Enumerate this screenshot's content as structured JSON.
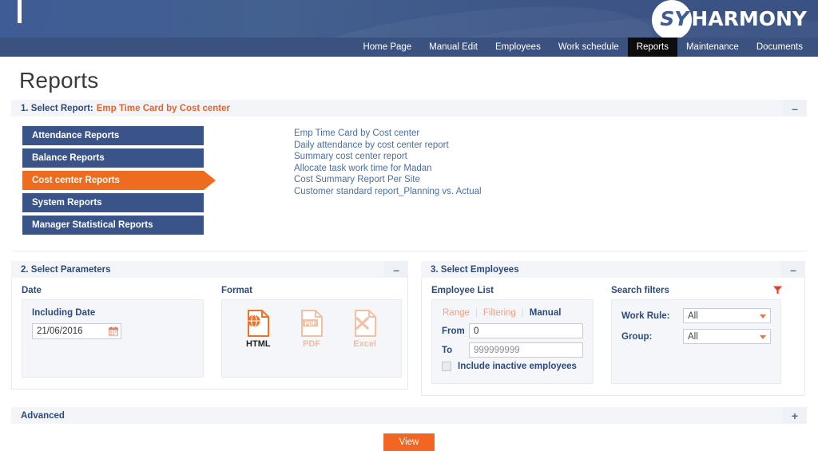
{
  "brand": {
    "logo_sy": "SY",
    "logo_harmony": "HARMONY"
  },
  "nav": {
    "items": [
      {
        "label": "Home Page",
        "active": false
      },
      {
        "label": "Manual Edit",
        "active": false
      },
      {
        "label": "Employees",
        "active": false
      },
      {
        "label": "Work schedule",
        "active": false
      },
      {
        "label": "Reports",
        "active": true
      },
      {
        "label": "Maintenance",
        "active": false
      },
      {
        "label": "Documents",
        "active": false
      }
    ]
  },
  "page": {
    "title": "Reports"
  },
  "section1": {
    "header_label": "1. Select Report:",
    "selected_report": "Emp Time Card by Cost center",
    "toggle": "–",
    "categories": [
      {
        "label": "Attendance Reports",
        "active": false
      },
      {
        "label": "Balance Reports",
        "active": false
      },
      {
        "label": "Cost center Reports",
        "active": true
      },
      {
        "label": "System Reports",
        "active": false
      },
      {
        "label": "Manager Statistical Reports",
        "active": false
      }
    ],
    "reports": [
      "Emp Time Card by Cost center",
      "Daily attendance by cost center report",
      "Summary cost center report",
      "Allocate task work time for Madan",
      "Cost Summary Report Per Site",
      "Customer standard report_Planning vs. Actual"
    ]
  },
  "section2": {
    "header_label": "2. Select Parameters",
    "toggle": "–",
    "date": {
      "group_title": "Date",
      "field_label": "Including Date",
      "value": "21/06/2016",
      "icon": "calendar-icon"
    },
    "format": {
      "group_title": "Format",
      "options": [
        {
          "label": "HTML",
          "icon": "html-file-icon",
          "active": true
        },
        {
          "label": "PDF",
          "icon": "pdf-file-icon",
          "active": false
        },
        {
          "label": "Excel",
          "icon": "excel-file-icon",
          "active": false
        }
      ]
    }
  },
  "section3": {
    "header_label": "3. Select Employees",
    "toggle": "–",
    "employee_list": {
      "group_title": "Employee List",
      "tabs": [
        {
          "label": "Range",
          "active": false
        },
        {
          "label": "Filtering",
          "active": false
        },
        {
          "label": "Manual",
          "active": true
        }
      ],
      "from_label": "From",
      "from_value": "0",
      "to_label": "To",
      "to_value": "999999999",
      "checkbox_label": "Include inactive employees",
      "checkbox_checked": false
    },
    "search_filters": {
      "group_title": "Search filters",
      "filter_icon": "funnel-icon",
      "fields": [
        {
          "label": "Work Rule:",
          "value": "All"
        },
        {
          "label": "Group:",
          "value": "All"
        }
      ]
    }
  },
  "advanced": {
    "label": "Advanced",
    "toggle": "+"
  },
  "footer": {
    "view_label": "View"
  },
  "colors": {
    "brand_blue": "#3b5280",
    "accent_orange": "#f26522",
    "category_blue": "#3a5389",
    "link_blue": "#4a6fa5",
    "header_text": "#2c4a7c"
  }
}
